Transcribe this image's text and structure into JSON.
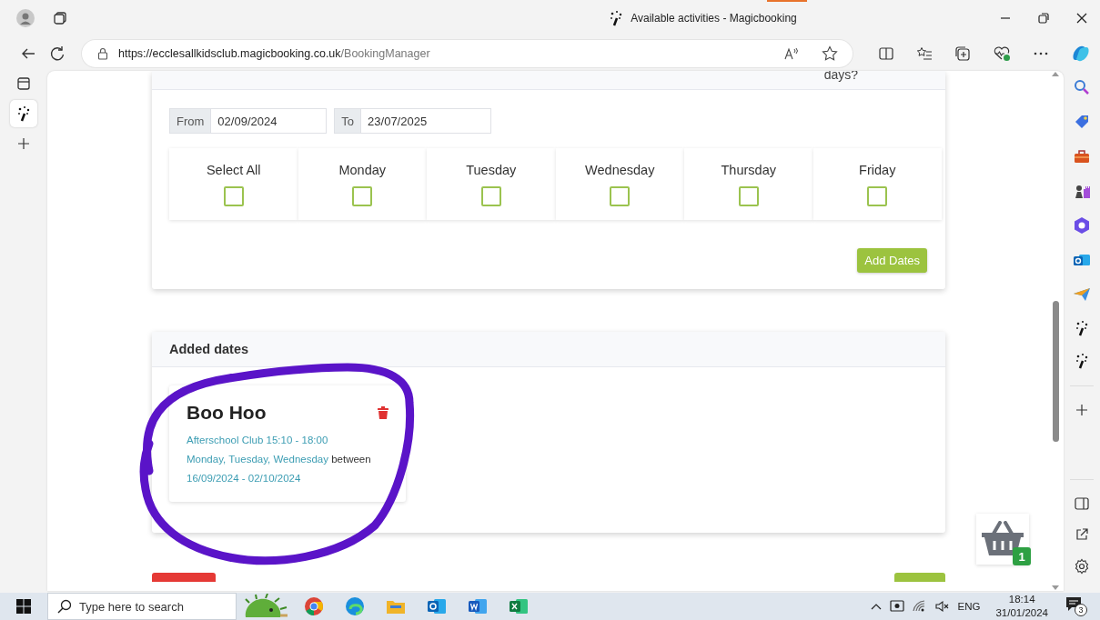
{
  "browser": {
    "tab_title": "Available activities - Magicbooking",
    "url_host": "https://ecclesallkidsclub.magicbooking.co.uk",
    "url_path": "/BookingManager"
  },
  "page": {
    "header_text": "days?",
    "from": {
      "label": "From",
      "value": "02/09/2024"
    },
    "to": {
      "label": "To",
      "value": "23/07/2025"
    },
    "days": [
      {
        "label": "Select All",
        "checked": false
      },
      {
        "label": "Monday",
        "checked": false
      },
      {
        "label": "Tuesday",
        "checked": false
      },
      {
        "label": "Wednesday",
        "checked": false
      },
      {
        "label": "Thursday",
        "checked": false
      },
      {
        "label": "Friday",
        "checked": false
      }
    ],
    "add_button": "Add Dates",
    "added_dates": {
      "title": "Added dates",
      "bookings": [
        {
          "name": "Boo Hoo",
          "activity": "Afterschool Club 15:10 - 18:00",
          "days": "Monday, Tuesday, Wednesday",
          "between": "between",
          "dates": "16/09/2024 - 02/10/2024"
        }
      ]
    },
    "basket_count": "1"
  },
  "taskbar": {
    "search_placeholder": "Type here to search",
    "language": "ENG",
    "time": "18:14",
    "date": "31/01/2024",
    "notifications": "3"
  }
}
